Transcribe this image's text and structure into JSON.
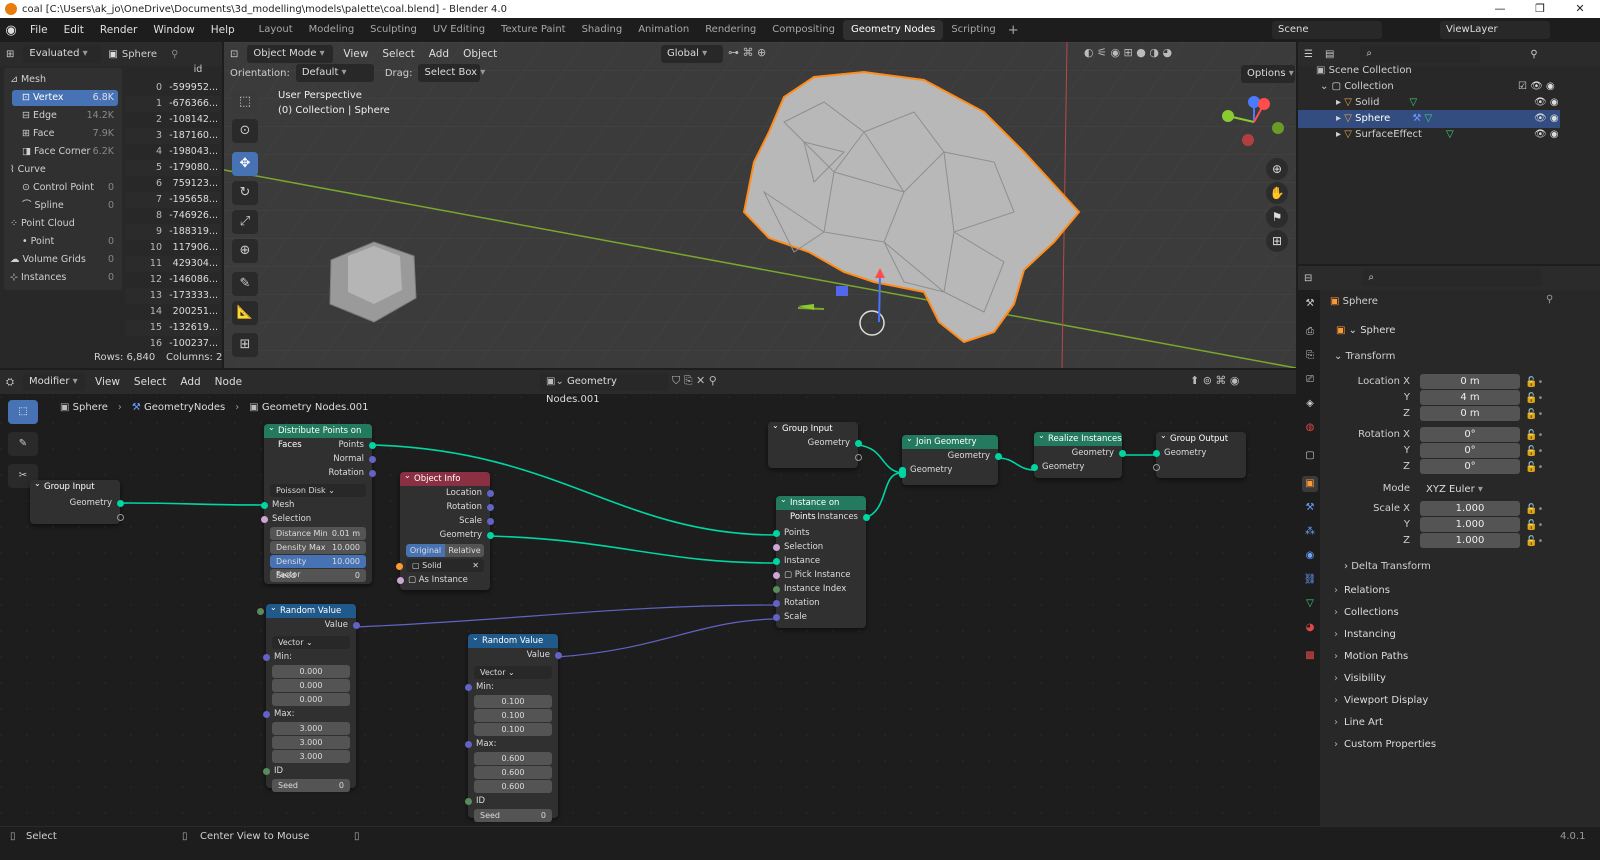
{
  "window": {
    "title": "coal [C:\\Users\\ak_jo\\OneDrive\\Documents\\3d_modelling\\models\\palette\\coal.blend] - Blender 4.0",
    "minimize": "—",
    "maximize": "❐",
    "close": "✕"
  },
  "menu": [
    "File",
    "Edit",
    "Render",
    "Window",
    "Help"
  ],
  "workspaces": [
    "Layout",
    "Modeling",
    "Sculpting",
    "UV Editing",
    "Texture Paint",
    "Shading",
    "Animation",
    "Rendering",
    "Compositing",
    "Geometry Nodes",
    "Scripting"
  ],
  "active_workspace": "Geometry Nodes",
  "scene": {
    "name": "Scene",
    "view_layer": "ViewLayer"
  },
  "spreadsheet": {
    "mode": "Evaluated",
    "object": "Sphere",
    "column": "id",
    "domains": [
      {
        "label": "Mesh",
        "count": ""
      },
      {
        "label": "Vertex",
        "count": "6.8K",
        "active": true
      },
      {
        "label": "Edge",
        "count": "14.2K"
      },
      {
        "label": "Face",
        "count": "7.9K"
      },
      {
        "label": "Face Corner",
        "count": "6.2K"
      },
      {
        "label": "Curve",
        "count": ""
      },
      {
        "label": "Control Point",
        "count": "0"
      },
      {
        "label": "Spline",
        "count": "0"
      },
      {
        "label": "Point Cloud",
        "count": ""
      },
      {
        "label": "Point",
        "count": "0"
      },
      {
        "label": "Volume Grids",
        "count": "0"
      },
      {
        "label": "Instances",
        "count": "0"
      }
    ],
    "rows": [
      [
        "0",
        "-599952..."
      ],
      [
        "1",
        "-676366..."
      ],
      [
        "2",
        "-108142..."
      ],
      [
        "3",
        "-187160..."
      ],
      [
        "4",
        "-198043..."
      ],
      [
        "5",
        "-179080..."
      ],
      [
        "6",
        "759123..."
      ],
      [
        "7",
        "-195658..."
      ],
      [
        "8",
        "-746926..."
      ],
      [
        "9",
        "-188319..."
      ],
      [
        "10",
        "117906..."
      ],
      [
        "11",
        "429304..."
      ],
      [
        "12",
        "-146086..."
      ],
      [
        "13",
        "-173333..."
      ],
      [
        "14",
        "200251..."
      ],
      [
        "15",
        "-132619..."
      ],
      [
        "16",
        "-100237..."
      ]
    ],
    "footer_rows": "Rows: 6,840",
    "footer_cols": "Columns: 2"
  },
  "viewport": {
    "mode": "Object Mode",
    "menu": [
      "View",
      "Select",
      "Add",
      "Object"
    ],
    "transform": "Global",
    "orientation_label": "Orientation:",
    "orientation": "Default",
    "drag_label": "Drag:",
    "drag": "Select Box",
    "options": "Options",
    "overlay_title": "User Perspective",
    "overlay_sub": "(0) Collection | Sphere"
  },
  "outliner": {
    "root": "Scene Collection",
    "collection": "Collection",
    "items": [
      "Solid",
      "Sphere",
      "SurfaceEffect"
    ],
    "active": "Sphere"
  },
  "properties": {
    "object": "Sphere",
    "data": "Sphere",
    "transform_label": "Transform",
    "location": {
      "label": "Location X",
      "x": "0 m",
      "y": "4 m",
      "z": "0 m"
    },
    "rotation": {
      "label": "Rotation X",
      "x": "0°",
      "y": "0°",
      "z": "0°"
    },
    "mode_label": "Mode",
    "mode": "XYZ Euler",
    "scale": {
      "label": "Scale X",
      "x": "1.000",
      "y": "1.000",
      "z": "1.000"
    },
    "y": "Y",
    "z": "Z",
    "delta": "Delta Transform",
    "sections": [
      "Relations",
      "Collections",
      "Instancing",
      "Motion Paths",
      "Visibility",
      "Viewport Display",
      "Line Art",
      "Custom Properties"
    ]
  },
  "node_editor": {
    "type": "Modifier",
    "menu": [
      "View",
      "Select",
      "Add",
      "Node"
    ],
    "tree": "Geometry Nodes.001",
    "breadcrumb": [
      "Sphere",
      "GeometryNodes",
      "Geometry Nodes.001"
    ]
  },
  "nodes": {
    "group_input_a": {
      "title": "Group Input",
      "out": "Geometry"
    },
    "group_input_b": {
      "title": "Group Input",
      "out": "Geometry"
    },
    "distribute": {
      "title": "Distribute Points on Faces",
      "outs": [
        "Points",
        "Normal",
        "Rotation"
      ],
      "mode": "Poisson Disk",
      "ins": [
        "Mesh",
        "Selection"
      ],
      "fields": [
        [
          "Distance Min",
          "0.01 m"
        ],
        [
          "Density Max",
          "10.000"
        ],
        [
          "Density Factor",
          "10.000"
        ],
        [
          "Seed",
          "0"
        ]
      ]
    },
    "object_info": {
      "title": "Object Info",
      "outs": [
        "Location",
        "Rotation",
        "Scale",
        "Geometry"
      ],
      "btn_a": "Original",
      "btn_b": "Relative",
      "object": "Solid",
      "as_instance": "As Instance"
    },
    "random_a": {
      "title": "Random Value",
      "out": "Value",
      "type": "Vector",
      "min": "Min:",
      "min_vals": [
        "0.000",
        "0.000",
        "0.000"
      ],
      "max": "Max:",
      "max_vals": [
        "3.000",
        "3.000",
        "3.000"
      ],
      "id": "ID",
      "seed": [
        "Seed",
        "0"
      ]
    },
    "random_b": {
      "title": "Random Value",
      "out": "Value",
      "type": "Vector",
      "min": "Min:",
      "min_vals": [
        "0.100",
        "0.100",
        "0.100"
      ],
      "max": "Max:",
      "max_vals": [
        "0.600",
        "0.600",
        "0.600"
      ],
      "id": "ID",
      "seed": [
        "Seed",
        "0"
      ]
    },
    "instance": {
      "title": "Instance on Points",
      "out": "Instances",
      "ins": [
        "Points",
        "Selection",
        "Instance",
        "Pick Instance",
        "Instance Index",
        "Rotation",
        "Scale"
      ]
    },
    "join": {
      "title": "Join Geometry",
      "out": "Geometry",
      "in": "Geometry"
    },
    "realize": {
      "title": "Realize Instances",
      "out": "Geometry",
      "in": "Geometry"
    },
    "group_output": {
      "title": "Group Output",
      "in": "Geometry"
    }
  },
  "status": {
    "left": "Select",
    "mid": "Center View to Mouse",
    "version": "4.0.1"
  },
  "colors": {
    "accent": "#4772b3",
    "geometry_socket": "#00d6a3",
    "vector_socket": "#6363c7",
    "orange": "#e87d0d"
  }
}
